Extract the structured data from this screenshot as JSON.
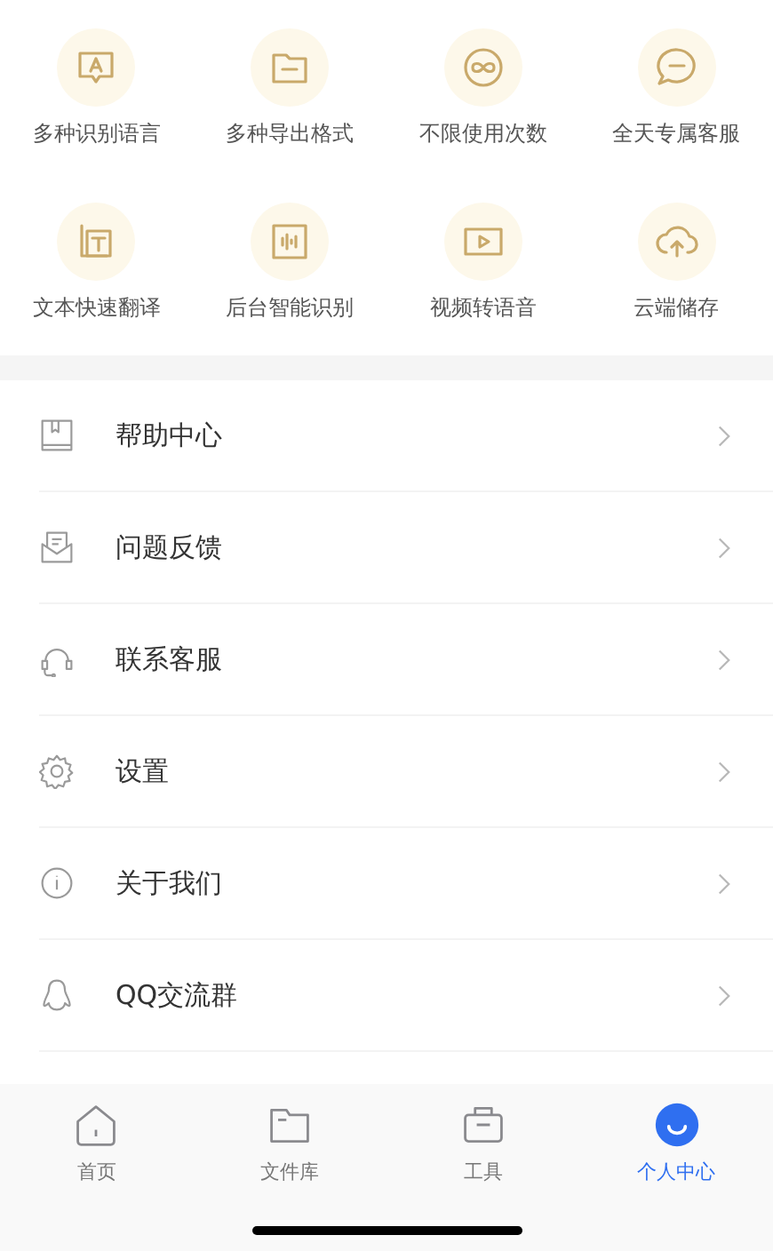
{
  "features": [
    {
      "kind": "language",
      "label": "多种识别语言"
    },
    {
      "kind": "export",
      "label": "多种导出格式"
    },
    {
      "kind": "unlimited",
      "label": "不限使用次数"
    },
    {
      "kind": "service",
      "label": "全天专属客服"
    },
    {
      "kind": "translate",
      "label": "文本快速翻译"
    },
    {
      "kind": "background",
      "label": "后台智能识别"
    },
    {
      "kind": "video",
      "label": "视频转语音"
    },
    {
      "kind": "cloud",
      "label": "云端储存"
    }
  ],
  "menu": [
    {
      "kind": "help",
      "label": "帮助中心"
    },
    {
      "kind": "feedback",
      "label": "问题反馈"
    },
    {
      "kind": "support",
      "label": "联系客服"
    },
    {
      "kind": "settings",
      "label": "设置"
    },
    {
      "kind": "about",
      "label": "关于我们"
    },
    {
      "kind": "group",
      "label": "QQ交流群"
    }
  ],
  "tabs": [
    {
      "kind": "home",
      "label": "首页",
      "selected": false
    },
    {
      "kind": "files",
      "label": "文件库",
      "selected": false
    },
    {
      "kind": "tools",
      "label": "工具",
      "selected": false
    },
    {
      "kind": "profile",
      "label": "个人中心",
      "selected": true
    }
  ]
}
